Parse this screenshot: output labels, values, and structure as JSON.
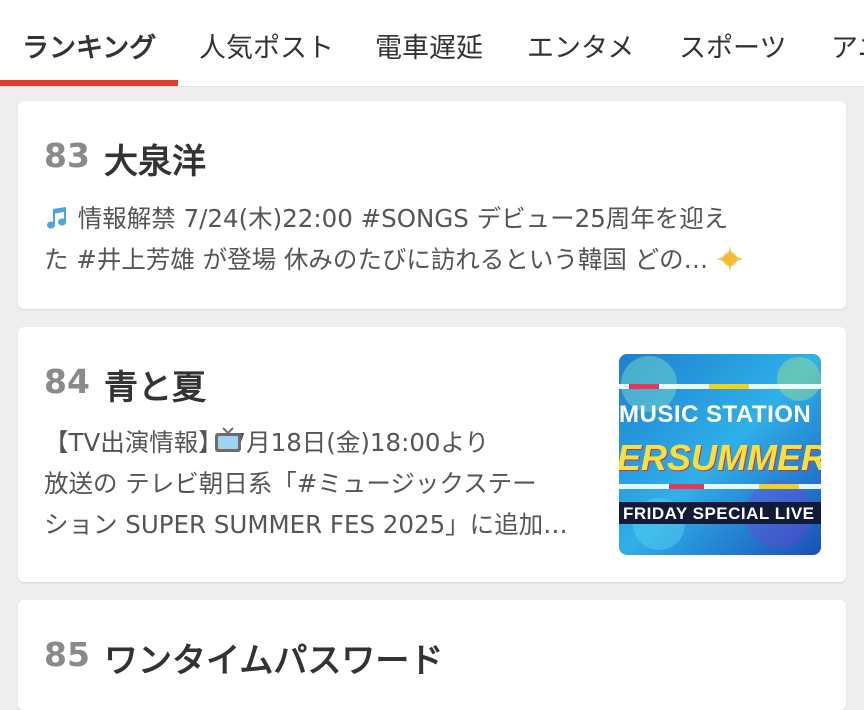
{
  "tabs": [
    {
      "label": "ランキング",
      "active": true
    },
    {
      "label": "人気ポスト"
    },
    {
      "label": "電車遅延"
    },
    {
      "label": "エンタメ"
    },
    {
      "label": "スポーツ"
    },
    {
      "label": "アニ"
    }
  ],
  "accent_color": "#e03c31",
  "items": [
    {
      "rank": "83",
      "title": "大泉洋",
      "desc_lines": [
        "情報解禁 7/24(木)22:00 #SONGS  デビュー25周年を迎え",
        "た #井上芳雄 が登場 休みのたびに訪れるという韓国 どの…"
      ],
      "icons": [
        "music-note-icon",
        "sparkle-icon"
      ]
    },
    {
      "rank": "84",
      "title": "青と夏",
      "desc_lines": [
        "【TV出演情報】  7月18日(金)18:00より",
        "放送の テレビ朝日系「#ミュージックステー",
        "ション SUPER SUMMER FES 2025」に追加…"
      ],
      "icons": [
        "television-icon"
      ],
      "thumbnail": {
        "line1": "MUSIC STATION",
        "line2": "ERSUMMER",
        "line3": "FRIDAY SPECIAL LIVE"
      }
    },
    {
      "rank": "85",
      "title": "ワンタイムパスワード"
    }
  ]
}
